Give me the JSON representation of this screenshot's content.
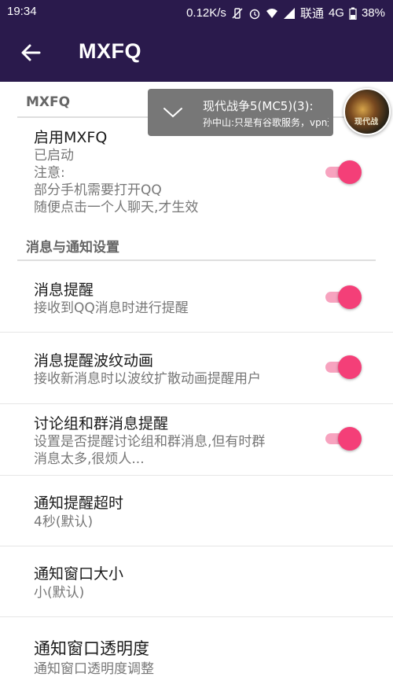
{
  "status_bar": {
    "time": "19:34",
    "speed": "0.12K/s",
    "carrier": "联通",
    "network": "4G",
    "battery": "38%"
  },
  "toolbar": {
    "title": "MXFQ"
  },
  "sections": {
    "mxfq_header": "MXFQ",
    "notify_header": "消息与通知设置"
  },
  "items": {
    "enable": {
      "title": "启用MXFQ",
      "subtitle": "已启动\n注意:\n部分手机需要打开QQ\n随便点击一个人聊天,才生效",
      "on": true
    },
    "msg_alert": {
      "title": "消息提醒",
      "subtitle": "接收到QQ消息时进行提醒",
      "on": true
    },
    "ripple": {
      "title": "消息提醒波纹动画",
      "subtitle": "接收新消息时以波纹扩散动画提醒用户",
      "on": true
    },
    "group_alert": {
      "title": "讨论组和群消息提醒",
      "subtitle": "设置是否提醒讨论组和群消息,但有时群\n消息太多,很烦人...",
      "on": true
    },
    "timeout": {
      "title": "通知提醒超时",
      "subtitle": "4秒(默认)"
    },
    "window_size": {
      "title": "通知窗口大小",
      "subtitle": "小(默认)"
    },
    "transparency": {
      "title": "通知窗口透明度",
      "subtitle": "通知窗口透明度调整"
    }
  },
  "notification": {
    "title": "现代战争5(MC5)(3):",
    "message": "孙中山:只是有谷歌服务，vpn还...",
    "avatar_text": "现代战"
  },
  "colors": {
    "toolbar": "#2a1a4c",
    "switch_thumb": "#f43f78",
    "switch_track": "#f7a3bf"
  }
}
